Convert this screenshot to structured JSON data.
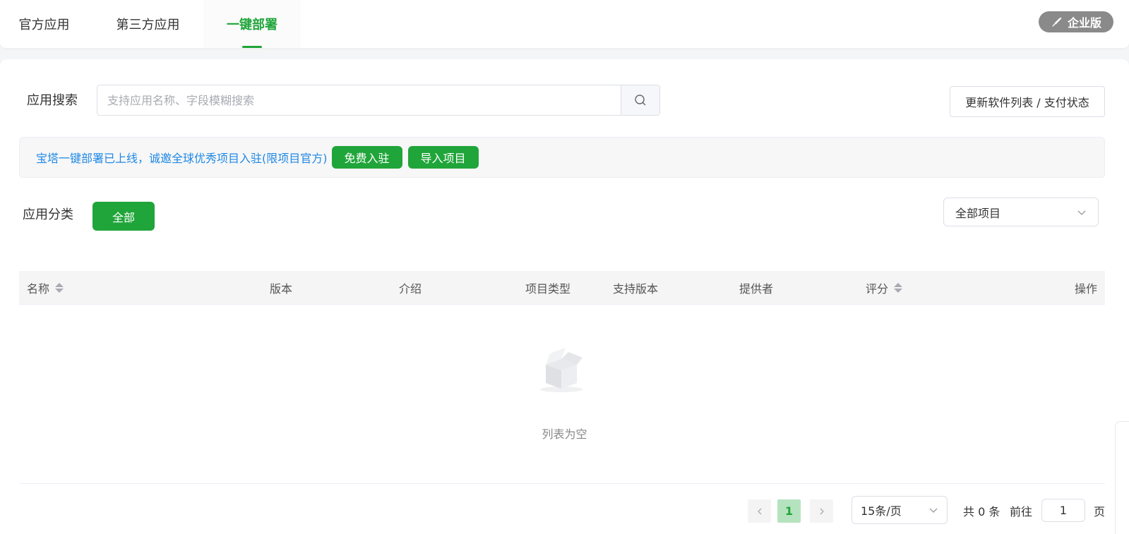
{
  "tabs": [
    {
      "label": "官方应用"
    },
    {
      "label": "第三方应用"
    },
    {
      "label": "一键部署"
    }
  ],
  "enterprise_label": "企业版",
  "search": {
    "label": "应用搜索",
    "placeholder": "支持应用名称、字段模糊搜索"
  },
  "update_button": "更新软件列表 / 支付状态",
  "notice": {
    "text": "宝塔一键部署已上线，诚邀全球优秀项目入驻(限项目官方)",
    "free_join": "免费入驻",
    "import_project": "导入项目"
  },
  "category": {
    "label": "应用分类",
    "all": "全部"
  },
  "project_select": "全部项目",
  "table": {
    "columns": [
      "名称",
      "版本",
      "介绍",
      "项目类型",
      "支持版本",
      "提供者",
      "评分",
      "操作"
    ],
    "empty_text": "列表为空"
  },
  "pagination": {
    "current_page": "1",
    "page_size": "15条/页",
    "total": "共 0 条",
    "goto": "前往",
    "goto_value": "1",
    "page_suffix": "页"
  },
  "colors": {
    "accent": "#20a53a",
    "link": "#1f88e5"
  }
}
